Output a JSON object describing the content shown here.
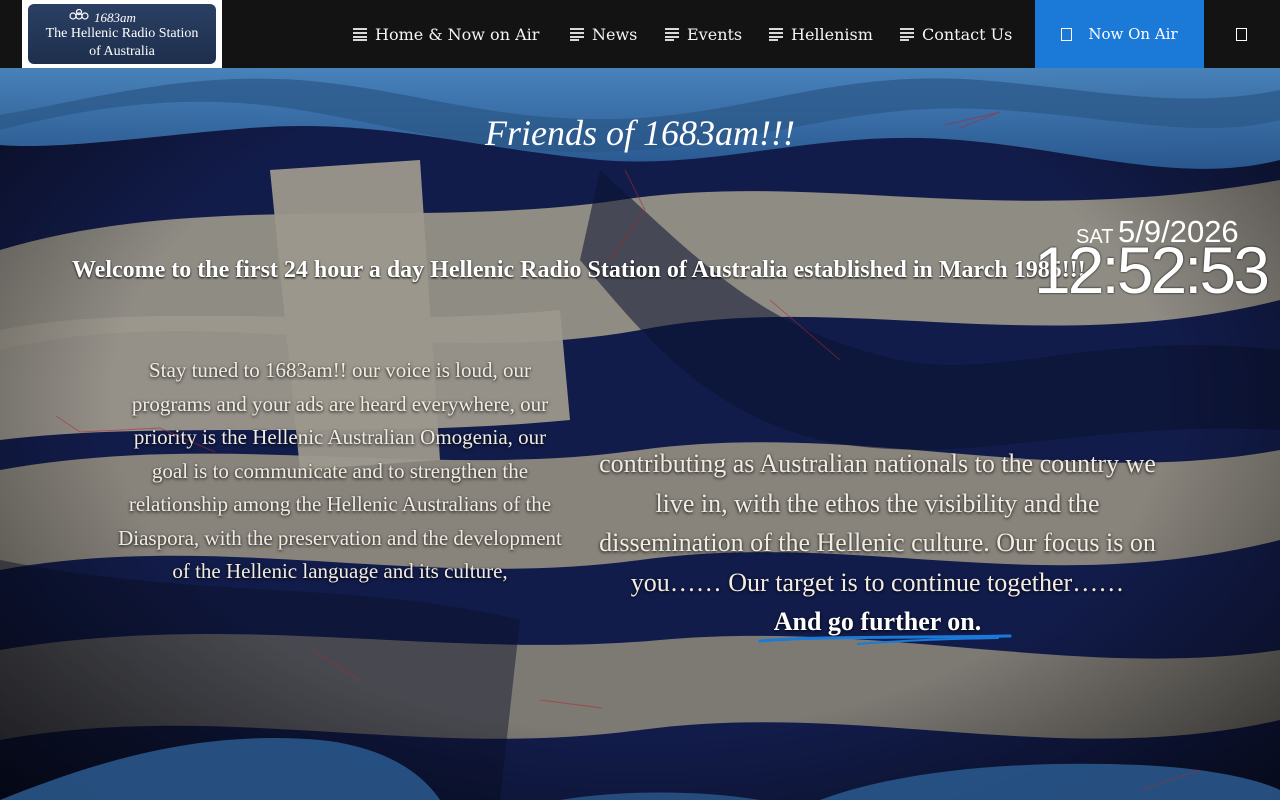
{
  "logo": {
    "small": "1683am",
    "line1": "The Hellenic Radio Station",
    "line2": "of Australia"
  },
  "nav": {
    "items": [
      {
        "label": "Home & Now on Air",
        "icon": "list-icon"
      },
      {
        "label": "News",
        "icon": "list-icon"
      },
      {
        "label": "Events",
        "icon": "list-icon"
      },
      {
        "label": "Hellenism",
        "icon": "list-icon"
      },
      {
        "label": "Contact Us",
        "icon": "list-icon"
      }
    ],
    "now_on_air": "Now On Air"
  },
  "hero": {
    "title": "Friends of 1683am!!!",
    "welcome": "Welcome to the first 24 hour a day Hellenic Radio Station of Australia established in March 1985!!!",
    "clock": {
      "day": "SAT",
      "date": "5/9/2026",
      "time": "12:52:53"
    },
    "left_text": "Stay tuned to 1683am!! our voice is loud, our programs and your ads are heard everywhere, our priority is the Hellenic Australian Omogenia, our goal is to communicate and to strengthen the relationship among the Hellenic Australians of the Diaspora, with the preservation and the development of the Hellenic language and its culture,",
    "right_text": "contributing as Australian nationals to the country we live in, with the ethos the visibility and the dissemination of the Hellenic culture. Our focus is on you…… Our target is to continue together……",
    "right_emphasis": "And go further on."
  },
  "colors": {
    "topbar": "#131313",
    "accent": "#1b79d8",
    "flag_blue": "#1f2f7a",
    "flag_white": "#d9d2c3"
  }
}
